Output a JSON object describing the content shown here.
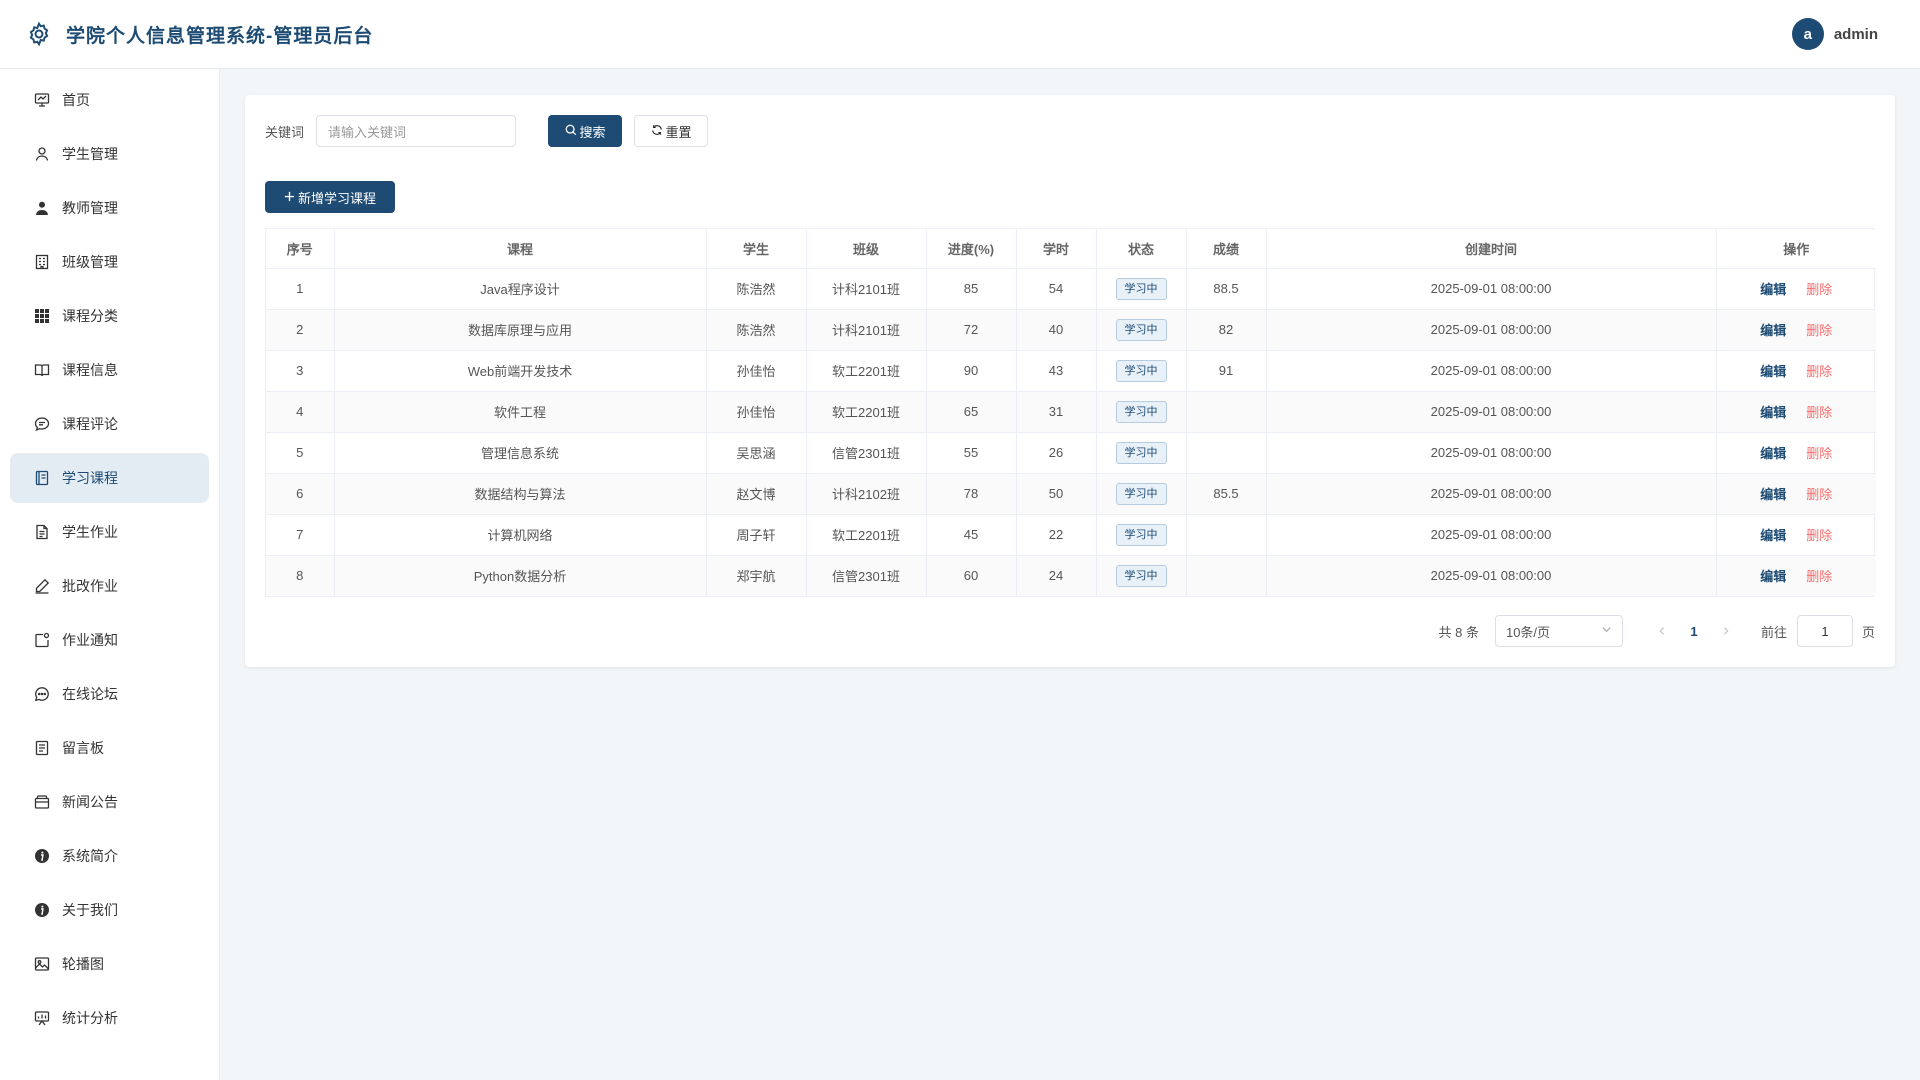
{
  "header": {
    "title": "学院个人信息管理系统-管理员后台",
    "avatar_letter": "a",
    "username": "admin"
  },
  "sidebar": {
    "items": [
      {
        "label": "首页",
        "icon": "presentation-chart-icon"
      },
      {
        "label": "学生管理",
        "icon": "user-outline-icon"
      },
      {
        "label": "教师管理",
        "icon": "user-solid-icon"
      },
      {
        "label": "班级管理",
        "icon": "building-icon"
      },
      {
        "label": "课程分类",
        "icon": "grid-icon"
      },
      {
        "label": "课程信息",
        "icon": "open-book-icon"
      },
      {
        "label": "课程评论",
        "icon": "chat-bubble-icon"
      },
      {
        "label": "学习课程",
        "icon": "notebook-icon",
        "active": true
      },
      {
        "label": "学生作业",
        "icon": "document-icon"
      },
      {
        "label": "批改作业",
        "icon": "edit-pen-icon"
      },
      {
        "label": "作业通知",
        "icon": "notification-icon"
      },
      {
        "label": "在线论坛",
        "icon": "chat-dots-icon"
      },
      {
        "label": "留言板",
        "icon": "memo-icon"
      },
      {
        "label": "新闻公告",
        "icon": "wallet-icon"
      },
      {
        "label": "系统简介",
        "icon": "info-icon"
      },
      {
        "label": "关于我们",
        "icon": "info-icon"
      },
      {
        "label": "轮播图",
        "icon": "picture-icon"
      },
      {
        "label": "统计分析",
        "icon": "chart-board-icon"
      }
    ]
  },
  "search": {
    "label": "关键词",
    "placeholder": "请输入关键词",
    "search_label": "搜索",
    "reset_label": "重置"
  },
  "add_label": "新增学习课程",
  "table": {
    "columns": [
      "序号",
      "课程",
      "学生",
      "班级",
      "进度(%)",
      "学时",
      "状态",
      "成绩",
      "创建时间",
      "操作"
    ],
    "rows": [
      {
        "idx": "1",
        "course": "Java程序设计",
        "student": "陈浩然",
        "class": "计科2101班",
        "progress": "85",
        "hours": "54",
        "status": "学习中",
        "score": "88.5",
        "created": "2025-09-01 08:00:00"
      },
      {
        "idx": "2",
        "course": "数据库原理与应用",
        "student": "陈浩然",
        "class": "计科2101班",
        "progress": "72",
        "hours": "40",
        "status": "学习中",
        "score": "82",
        "created": "2025-09-01 08:00:00"
      },
      {
        "idx": "3",
        "course": "Web前端开发技术",
        "student": "孙佳怡",
        "class": "软工2201班",
        "progress": "90",
        "hours": "43",
        "status": "学习中",
        "score": "91",
        "created": "2025-09-01 08:00:00"
      },
      {
        "idx": "4",
        "course": "软件工程",
        "student": "孙佳怡",
        "class": "软工2201班",
        "progress": "65",
        "hours": "31",
        "status": "学习中",
        "score": "",
        "created": "2025-09-01 08:00:00"
      },
      {
        "idx": "5",
        "course": "管理信息系统",
        "student": "吴思涵",
        "class": "信管2301班",
        "progress": "55",
        "hours": "26",
        "status": "学习中",
        "score": "",
        "created": "2025-09-01 08:00:00"
      },
      {
        "idx": "6",
        "course": "数据结构与算法",
        "student": "赵文博",
        "class": "计科2102班",
        "progress": "78",
        "hours": "50",
        "status": "学习中",
        "score": "85.5",
        "created": "2025-09-01 08:00:00"
      },
      {
        "idx": "7",
        "course": "计算机网络",
        "student": "周子轩",
        "class": "软工2201班",
        "progress": "45",
        "hours": "22",
        "status": "学习中",
        "score": "",
        "created": "2025-09-01 08:00:00"
      },
      {
        "idx": "8",
        "course": "Python数据分析",
        "student": "郑宇航",
        "class": "信管2301班",
        "progress": "60",
        "hours": "24",
        "status": "学习中",
        "score": "",
        "created": "2025-09-01 08:00:00"
      }
    ],
    "edit_label": "编辑",
    "delete_label": "删除"
  },
  "pager": {
    "total": "共 8 条",
    "page_size": "10条/页",
    "current_page": "1",
    "goto_label": "前往",
    "goto_value": "1",
    "page_suffix": "页"
  },
  "colors": {
    "primary": "#1d4b73",
    "danger": "#f56c6c",
    "page_bg": "#f3f6f9",
    "active_nav_bg": "#e3ebf3"
  }
}
